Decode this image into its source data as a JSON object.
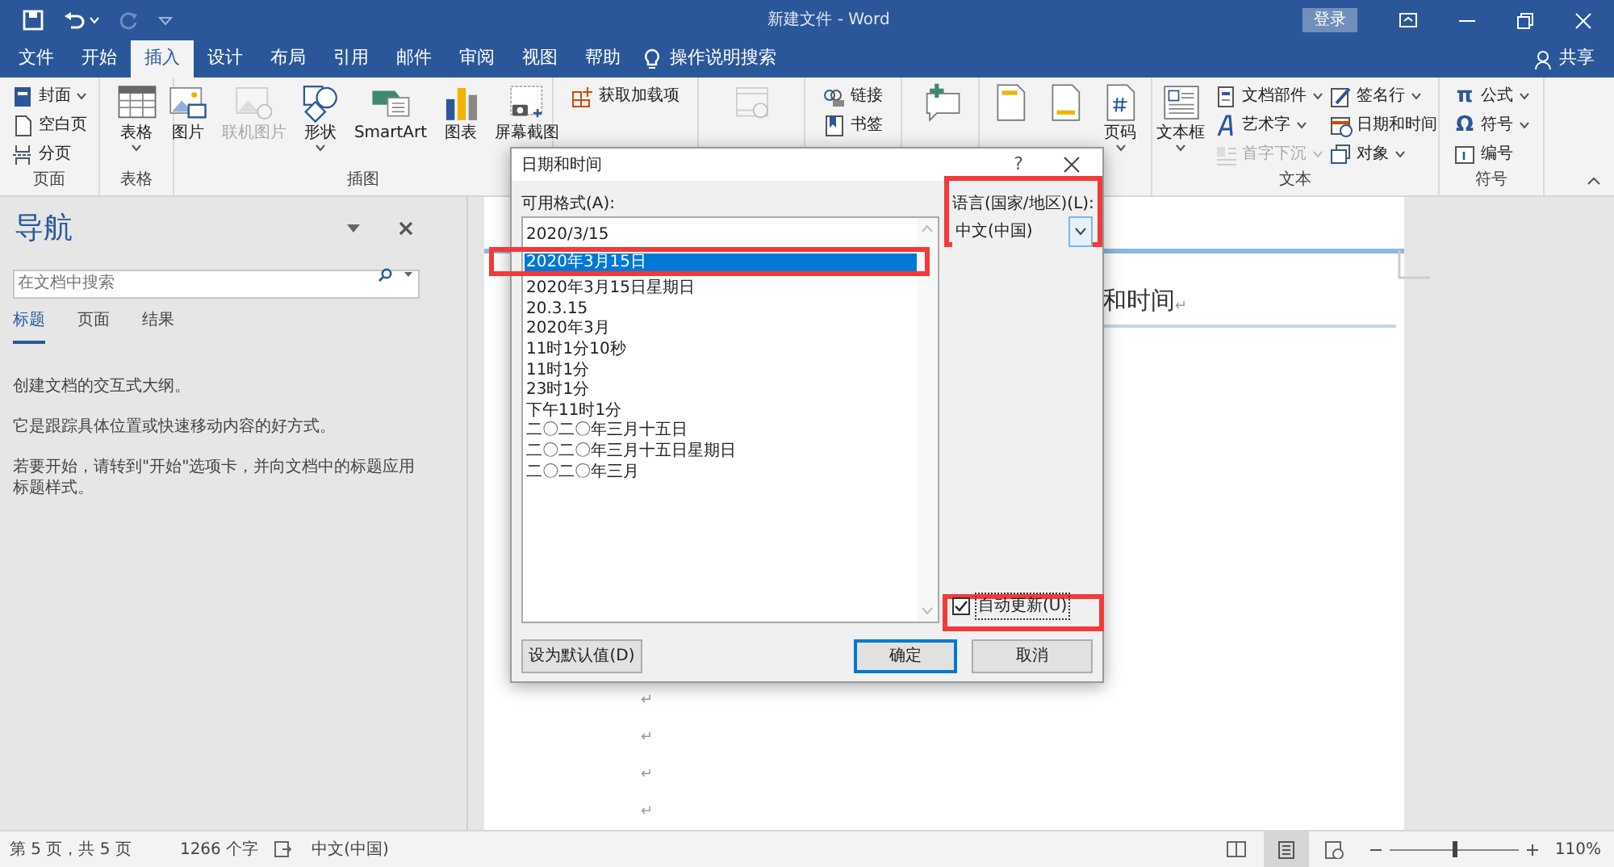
{
  "title_bar": {
    "title": "新建文件 - Word",
    "sign_in": "登录"
  },
  "menu_tabs": [
    {
      "label": "文件",
      "selected": false
    },
    {
      "label": "开始",
      "selected": false
    },
    {
      "label": "插入",
      "selected": true
    },
    {
      "label": "设计",
      "selected": false
    },
    {
      "label": "布局",
      "selected": false
    },
    {
      "label": "引用",
      "selected": false
    },
    {
      "label": "邮件",
      "selected": false
    },
    {
      "label": "审阅",
      "selected": false
    },
    {
      "label": "视图",
      "selected": false
    },
    {
      "label": "帮助",
      "selected": false
    }
  ],
  "tell_me": "操作说明搜索",
  "share": "共享",
  "ribbon": {
    "groups": [
      {
        "label": "页面",
        "items": [
          {
            "kind": "small",
            "label": "封面",
            "dropdown": true
          },
          {
            "kind": "small",
            "label": "空白页"
          },
          {
            "kind": "small",
            "label": "分页"
          }
        ]
      },
      {
        "label": "表格",
        "items": [
          {
            "kind": "large",
            "label": "表格",
            "dropdown": true
          }
        ]
      },
      {
        "label": "插图",
        "items": [
          {
            "kind": "large",
            "label": "图片"
          },
          {
            "kind": "large",
            "label": "联机图片",
            "disabled": true
          },
          {
            "kind": "large",
            "label": "形状",
            "dropdown": true
          },
          {
            "kind": "large",
            "label": "SmartArt"
          },
          {
            "kind": "large",
            "label": "图表"
          },
          {
            "kind": "large",
            "label": "屏幕截图"
          }
        ]
      },
      {
        "items": [
          {
            "kind": "small",
            "label": "获取加载项"
          }
        ]
      },
      {
        "items": [
          {
            "kind": "large",
            "disabled": true
          }
        ]
      },
      {
        "items": [
          {
            "kind": "small",
            "label": "链接"
          },
          {
            "kind": "small",
            "label": "书签"
          }
        ]
      },
      {
        "items": [
          {
            "kind": "large"
          }
        ]
      },
      {
        "items": [
          {
            "kind": "large"
          },
          {
            "kind": "large"
          },
          {
            "kind": "large",
            "label": "页码",
            "dropdown": true
          }
        ]
      },
      {
        "label": "文本",
        "items": [
          {
            "kind": "large",
            "label": "文本框",
            "dropdown": true
          },
          {
            "kind": "small",
            "label": "文档部件",
            "dropdown": true
          },
          {
            "kind": "small",
            "label": "艺术字",
            "dropdown": true
          },
          {
            "kind": "small",
            "label": "首字下沉",
            "dropdown": true,
            "disabled": true
          },
          {
            "kind": "small",
            "label": "签名行",
            "dropdown": true
          },
          {
            "kind": "small",
            "label": "日期和时间"
          },
          {
            "kind": "small",
            "label": "对象",
            "dropdown": true
          }
        ]
      },
      {
        "label": "符号",
        "items": [
          {
            "kind": "small",
            "label": "公式",
            "icon_glyph": "π",
            "dropdown": true
          },
          {
            "kind": "small",
            "label": "符号",
            "icon_glyph": "Ω",
            "dropdown": true
          },
          {
            "kind": "small",
            "label": "编号"
          }
        ]
      }
    ]
  },
  "navigation": {
    "title": "导航",
    "search_placeholder": "在文档中搜索",
    "tabs": [
      {
        "label": "标题",
        "selected": true
      },
      {
        "label": "页面",
        "selected": false
      },
      {
        "label": "结果",
        "selected": false
      }
    ],
    "paragraphs": [
      "创建文档的交互式大纲。",
      "它是跟踪具体位置或快速移动内容的好方式。",
      "若要开始，请转到\"开始\"选项卡，并向文档中的标题应用标题样式。"
    ]
  },
  "document": {
    "heading": "和时间",
    "heading_mark": "↵",
    "paragraph_marks": [
      "↵",
      "↵",
      "↵",
      "↵"
    ]
  },
  "dialog": {
    "title": "日期和时间",
    "help": "?",
    "formats_label": "可用格式(A):",
    "formats": [
      {
        "text": "2020/3/15",
        "selected": false,
        "annotated": false
      },
      {
        "text": "2020年3月15日",
        "selected": true,
        "annotated": true
      },
      {
        "text": "2020年3月15日星期日",
        "selected": false,
        "annotated": false
      },
      {
        "text": "20.3.15",
        "selected": false,
        "annotated": false
      },
      {
        "text": "2020年3月",
        "selected": false,
        "annotated": false
      },
      {
        "text": "11时1分10秒",
        "selected": false,
        "annotated": false
      },
      {
        "text": "11时1分",
        "selected": false,
        "annotated": false
      },
      {
        "text": "23时1分",
        "selected": false,
        "annotated": false
      },
      {
        "text": "下午11时1分",
        "selected": false,
        "annotated": false
      },
      {
        "text": "二〇二〇年三月十五日",
        "selected": false,
        "annotated": false
      },
      {
        "text": "二〇二〇年三月十五日星期日",
        "selected": false,
        "annotated": false
      },
      {
        "text": "二〇二〇年三月",
        "selected": false,
        "annotated": false
      }
    ],
    "language_label": "语言(国家/地区)(L):",
    "language": "中文(中国)",
    "language_annotated": true,
    "auto_update": {
      "label": "自动更新(U)",
      "checked": true,
      "annotated": true
    },
    "buttons": [
      {
        "kind": "secondary",
        "label": "设为默认值(D)"
      },
      {
        "kind": "primary",
        "label": "确定"
      },
      {
        "kind": "secondary",
        "label": "取消"
      }
    ]
  },
  "status_bar": {
    "page": "第 5 页，共 5 页",
    "words": "1266 个字",
    "language": "中文(中国)",
    "zoom": {
      "level": 0.5,
      "reading": "110%"
    }
  }
}
